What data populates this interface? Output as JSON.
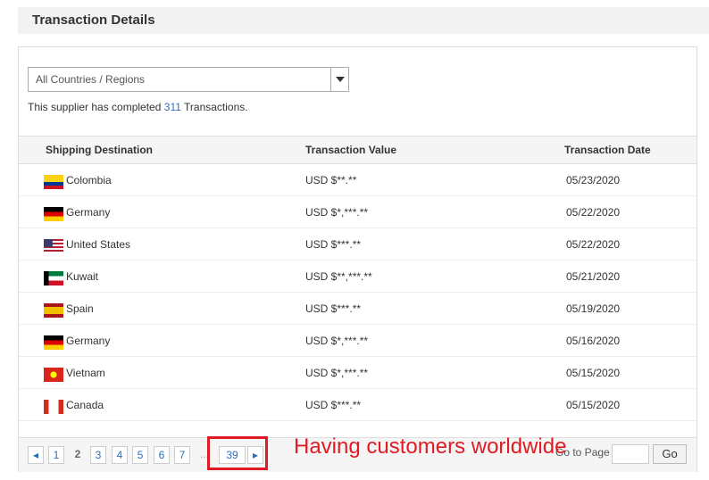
{
  "header": {
    "title": "Transaction Details"
  },
  "filter": {
    "selected": "All Countries / Regions"
  },
  "info": {
    "prefix": "This supplier has completed",
    "count": "311",
    "suffix": "Transactions."
  },
  "table": {
    "columns": [
      "Shipping Destination",
      "Transaction Value",
      "Transaction Date"
    ],
    "rows": [
      {
        "country": "Colombia",
        "flag": "colombia",
        "value": "USD $**.**",
        "date": "05/23/2020"
      },
      {
        "country": "Germany",
        "flag": "germany",
        "value": "USD $*,***.**",
        "date": "05/22/2020"
      },
      {
        "country": "United States",
        "flag": "usa",
        "value": "USD $***.**",
        "date": "05/22/2020"
      },
      {
        "country": "Kuwait",
        "flag": "kuwait",
        "value": "USD $**,***.**",
        "date": "05/21/2020"
      },
      {
        "country": "Spain",
        "flag": "spain",
        "value": "USD $***.**",
        "date": "05/19/2020"
      },
      {
        "country": "Germany",
        "flag": "germany",
        "value": "USD $*,***.**",
        "date": "05/16/2020"
      },
      {
        "country": "Vietnam",
        "flag": "vietnam",
        "value": "USD $*,***.**",
        "date": "05/15/2020"
      },
      {
        "country": "Canada",
        "flag": "canada",
        "value": "USD $***.**",
        "date": "05/15/2020"
      }
    ]
  },
  "pagination": {
    "pages": [
      "1",
      "2",
      "3",
      "4",
      "5",
      "6",
      "7"
    ],
    "ellipsis": "...",
    "last": "39",
    "current": "2",
    "goto_label": "Go to Page",
    "go_button": "Go"
  },
  "annotation": {
    "text": "Having customers worldwide",
    "color": "#e01b24"
  }
}
